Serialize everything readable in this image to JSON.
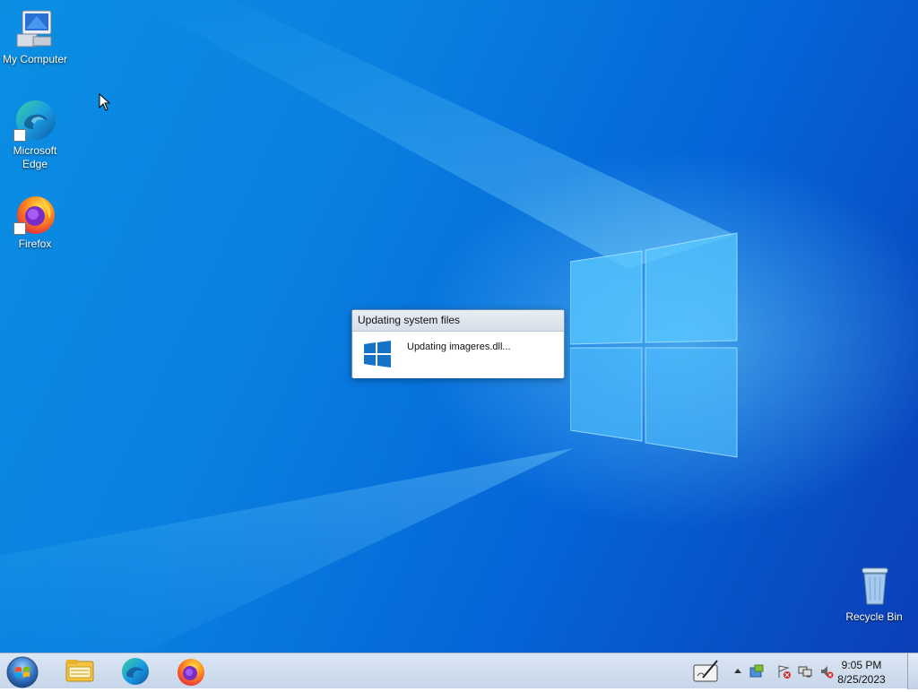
{
  "desktop": {
    "icons": [
      {
        "label": "My Computer",
        "icon": "computer-icon"
      },
      {
        "label": "Microsoft\nEdge",
        "icon": "edge-icon"
      },
      {
        "label": "Firefox",
        "icon": "firefox-icon"
      },
      {
        "label": "Recycle Bin",
        "icon": "recycle-bin-icon"
      }
    ]
  },
  "dialog": {
    "title": "Updating system files",
    "message": "Updating imageres.dll..."
  },
  "taskbar": {
    "pinned": [
      "file-explorer-icon",
      "edge-icon",
      "firefox-icon"
    ],
    "tray": {
      "icons": [
        "pen-tablet-icon",
        "show-hidden-icons-chevron",
        "windows-update-icon",
        "action-center-flag-icon",
        "network-icon",
        "volume-muted-icon"
      ],
      "time": "9:05 PM",
      "date": "8/25/2023"
    }
  },
  "colors": {
    "wallpaper": "#0a7fe0",
    "dialog_border": "#6b8fb0",
    "taskbar": "#c7d6ea"
  }
}
